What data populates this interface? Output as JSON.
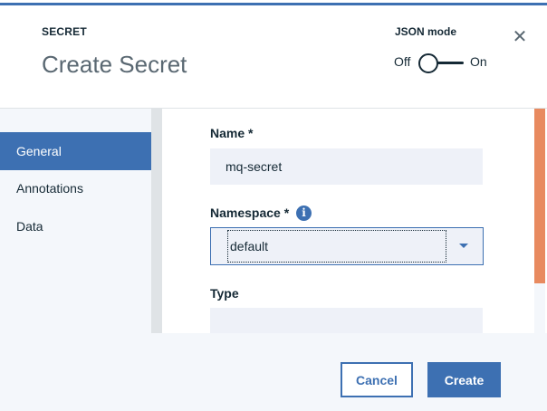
{
  "header": {
    "eyebrow": "SECRET",
    "title": "Create Secret",
    "json_mode_label": "JSON mode",
    "toggle_off_label": "Off",
    "toggle_on_label": "On",
    "toggle_state": "off",
    "close_icon": "close-icon"
  },
  "nav": {
    "items": [
      {
        "label": "General",
        "active": true
      },
      {
        "label": "Annotations",
        "active": false
      },
      {
        "label": "Data",
        "active": false
      }
    ]
  },
  "form": {
    "name_label": "Name *",
    "name_value": "mq-secret",
    "namespace_label": "Namespace *",
    "namespace_value": "default",
    "info_icon": "info-icon",
    "type_label": "Type",
    "type_value": ""
  },
  "footer": {
    "cancel_label": "Cancel",
    "create_label": "Create"
  },
  "colors": {
    "accent": "#3d70b2",
    "scroll_thumb": "#e88a5f",
    "nav_background": "#f4f7fb"
  }
}
